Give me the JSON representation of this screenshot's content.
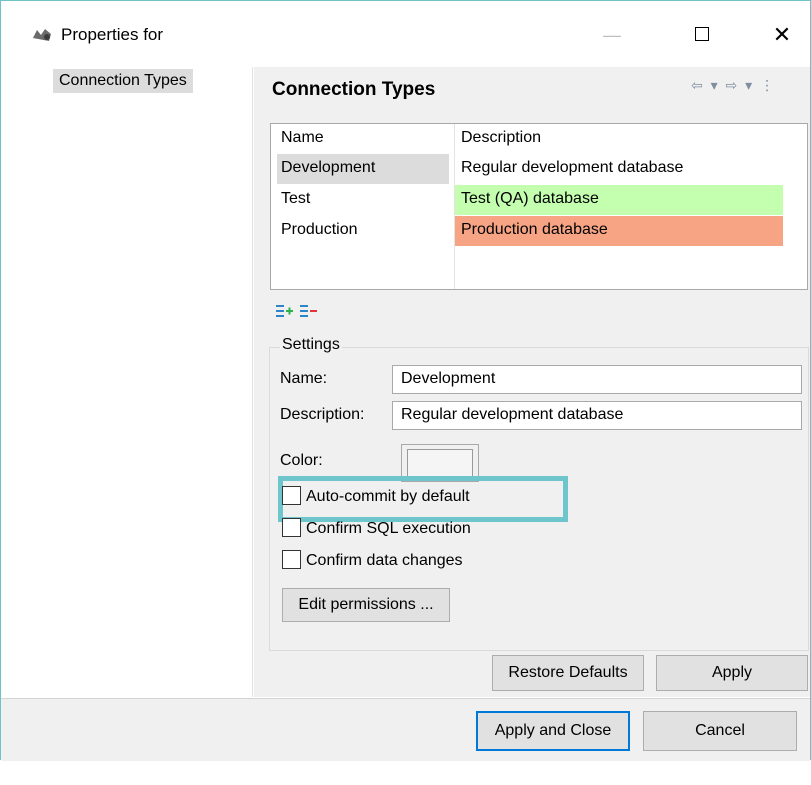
{
  "window": {
    "title": "Properties for",
    "minimize_icon": "minimize-icon",
    "maximize_icon": "maximize-icon",
    "close_glyph": "✕"
  },
  "nav": {
    "items": [
      {
        "label": "Connection Types",
        "selected": true
      }
    ]
  },
  "page": {
    "title": "Connection Types",
    "nav_arrows": "⇦ ▾ ⇨ ▾ ⋮"
  },
  "table": {
    "columns": [
      "Name",
      "Description"
    ],
    "rows": [
      {
        "name": "Development",
        "description": "Regular development database",
        "color": "#ffffff",
        "selected": true
      },
      {
        "name": "Test",
        "description": "Test (QA) database",
        "color": "#c4ffb0",
        "selected": false
      },
      {
        "name": "Production",
        "description": "Production database",
        "color": "#f7a484",
        "selected": false
      }
    ]
  },
  "list_actions": {
    "add_icon": "add-row-icon",
    "remove_icon": "remove-row-icon"
  },
  "settings": {
    "group_label": "Settings",
    "name_label": "Name:",
    "name_value": "Development",
    "description_label": "Description:",
    "description_value": "Regular development database",
    "color_label": "Color:",
    "auto_commit_label": "Auto-commit by default",
    "auto_commit_checked": false,
    "confirm_sql_label": "Confirm SQL execution",
    "confirm_sql_checked": false,
    "confirm_data_label": "Confirm data changes",
    "confirm_data_checked": false,
    "edit_permissions_label": "Edit permissions ..."
  },
  "buttons": {
    "restore_defaults": "Restore Defaults",
    "apply": "Apply",
    "apply_and_close": "Apply and Close",
    "cancel": "Cancel"
  },
  "colors": {
    "highlight": "#6ec6cc",
    "test_row": "#c4ffb0",
    "production_row": "#f7a484",
    "focus": "#0078d7"
  }
}
